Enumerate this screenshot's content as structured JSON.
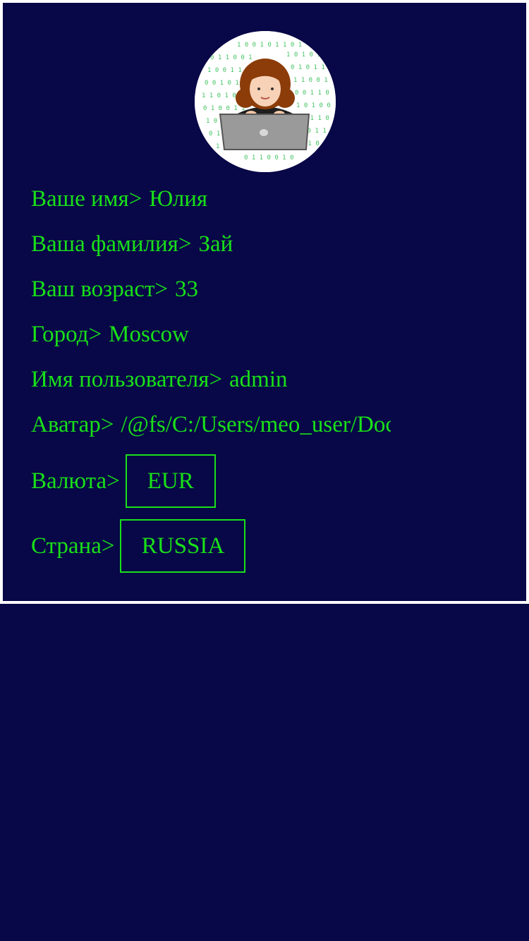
{
  "profile": {
    "first_name_label": "Ваше имя>",
    "first_name_value": "Юлия",
    "last_name_label": "Ваша фамилия>",
    "last_name_value": "Зай",
    "age_label": "Ваш возраст>",
    "age_value": "33",
    "city_label": "Город>",
    "city_value": "Moscow",
    "username_label": "Имя пользователя>",
    "username_value": "admin",
    "avatar_label": "Аватар>",
    "avatar_value": "/@fs/C:/Users/meo_user/Documents",
    "currency_label": "Валюта>",
    "currency_value": "EUR",
    "country_label": "Страна>",
    "country_value": "RUSSIA"
  },
  "avatar_image": {
    "icon": "woman-with-laptop-binary-background-icon"
  },
  "colors": {
    "background": "#080747",
    "text": "#19e019",
    "card_border": "#ffffff"
  }
}
